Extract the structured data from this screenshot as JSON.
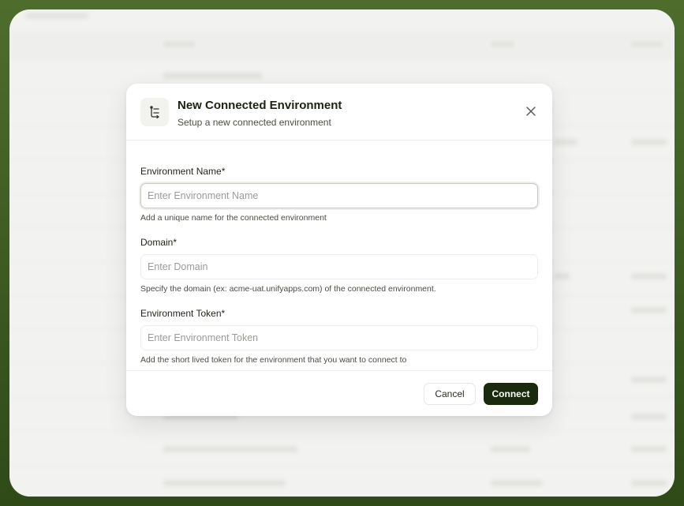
{
  "modal": {
    "title": "New Connected Environment",
    "subtitle": "Setup a new connected environment",
    "icon": "connected-environment-icon",
    "close_icon": "close-icon"
  },
  "fields": {
    "name": {
      "label": "Environment Name*",
      "value": "",
      "placeholder": "Enter Environment Name",
      "hint": "Add a unique name for the connected environment"
    },
    "domain": {
      "label": "Domain*",
      "value": "",
      "placeholder": "Enter Domain",
      "hint": "Specify the domain (ex: acme-uat.unifyapps.com) of the connected environment."
    },
    "token": {
      "label": "Environment Token*",
      "value": "",
      "placeholder": "Enter Environment Token",
      "hint": "Add the short lived token for the environment that you want to connect to"
    }
  },
  "footer": {
    "cancel_label": "Cancel",
    "connect_label": "Connect"
  },
  "colors": {
    "primary": "#1a2a0c",
    "backdrop": "#3c5a22"
  }
}
